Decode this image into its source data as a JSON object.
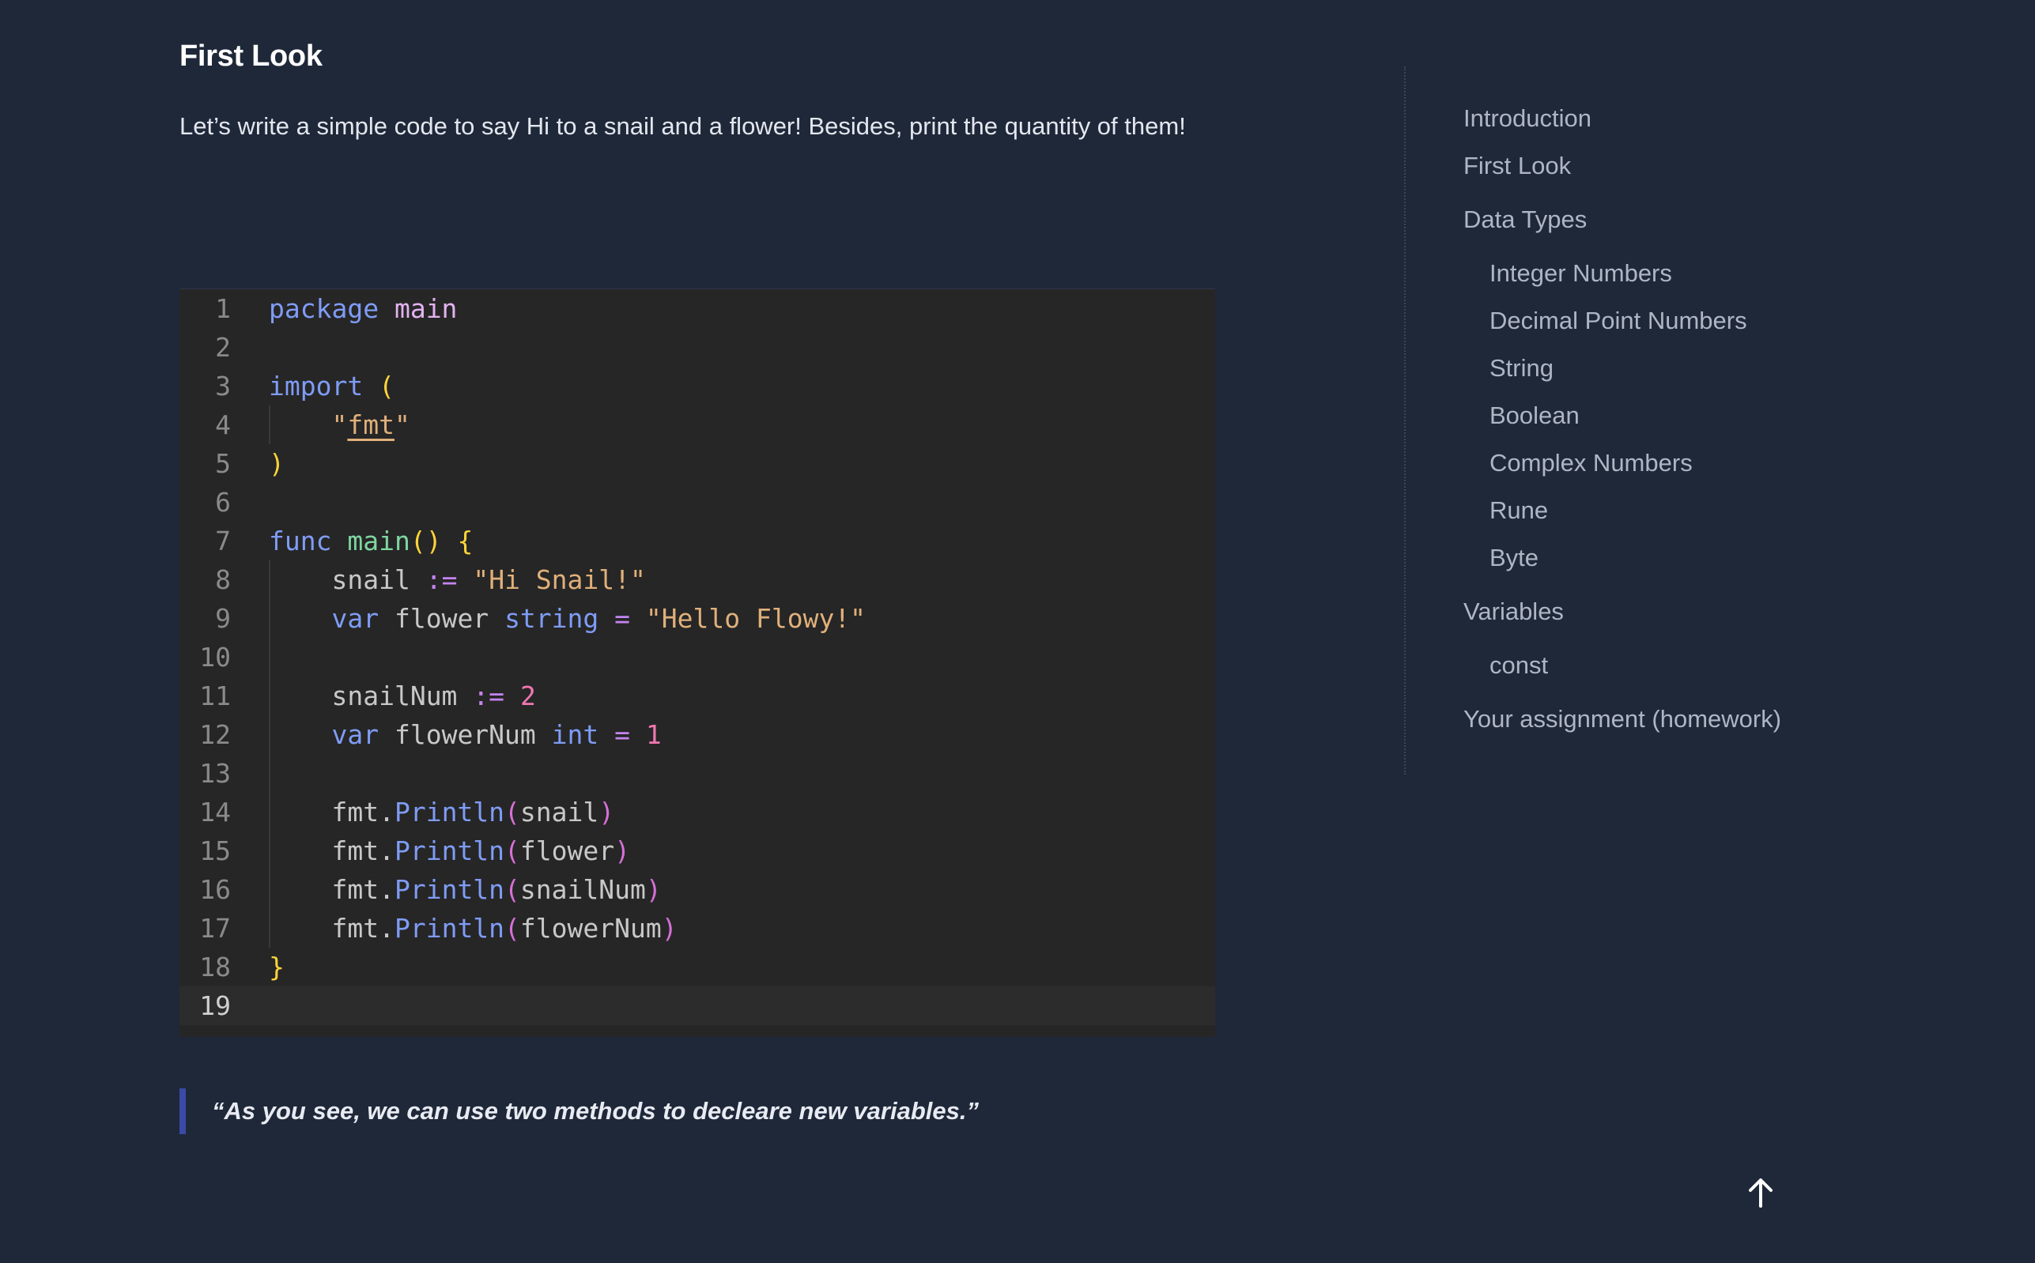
{
  "content": {
    "title": "First Look",
    "intro": "Let’s write a simple code to say Hi to a snail and a flower! Besides, print the quantity of them!",
    "quote": "“As you see, we can use two methods to decleare new variables.”"
  },
  "code": {
    "line_numbers": [
      "1",
      "2",
      "3",
      "4",
      "5",
      "6",
      "7",
      "8",
      "9",
      "10",
      "11",
      "12",
      "13",
      "14",
      "15",
      "16",
      "17",
      "18",
      "19"
    ],
    "tokens": {
      "package": "package",
      "main": "main",
      "import": "import",
      "open_paren": "(",
      "close_paren": ")",
      "quote": "\"",
      "fmt": "fmt",
      "func": "func",
      "main_fn": "main",
      "parens": "()",
      "open_brace": "{",
      "close_brace": "}",
      "snail": "snail",
      "decl": ":=",
      "hi_snail": "\"Hi Snail!\"",
      "var": "var",
      "flower": "flower",
      "string": "string",
      "eq": "=",
      "hello_flowy": "\"Hello Flowy!\"",
      "snailNum": "snailNum",
      "two": "2",
      "flowerNum": "flowerNum",
      "int": "int",
      "one": "1",
      "fmt_dot": "fmt.",
      "println": "Println"
    }
  },
  "toc": {
    "items": [
      {
        "label": "Introduction"
      },
      {
        "label": "First Look"
      },
      {
        "label": "Data Types"
      },
      {
        "label": "Integer Numbers"
      },
      {
        "label": "Decimal Point Numbers"
      },
      {
        "label": "String"
      },
      {
        "label": "Boolean"
      },
      {
        "label": "Complex Numbers"
      },
      {
        "label": "Rune"
      },
      {
        "label": "Byte"
      },
      {
        "label": "Variables"
      },
      {
        "label": "const"
      },
      {
        "label": "Your assignment (homework)"
      }
    ]
  },
  "icons": {
    "back_to_top": "arrow-up-icon"
  },
  "colors": {
    "background": "#1f2839",
    "code_background": "#262626",
    "quote_bar": "#3a4aa6",
    "keyword": "#7f9cf5",
    "string": "#e0b07a",
    "function": "#7fd6a0",
    "number": "#f077b0",
    "brace": "#ffd43b"
  }
}
